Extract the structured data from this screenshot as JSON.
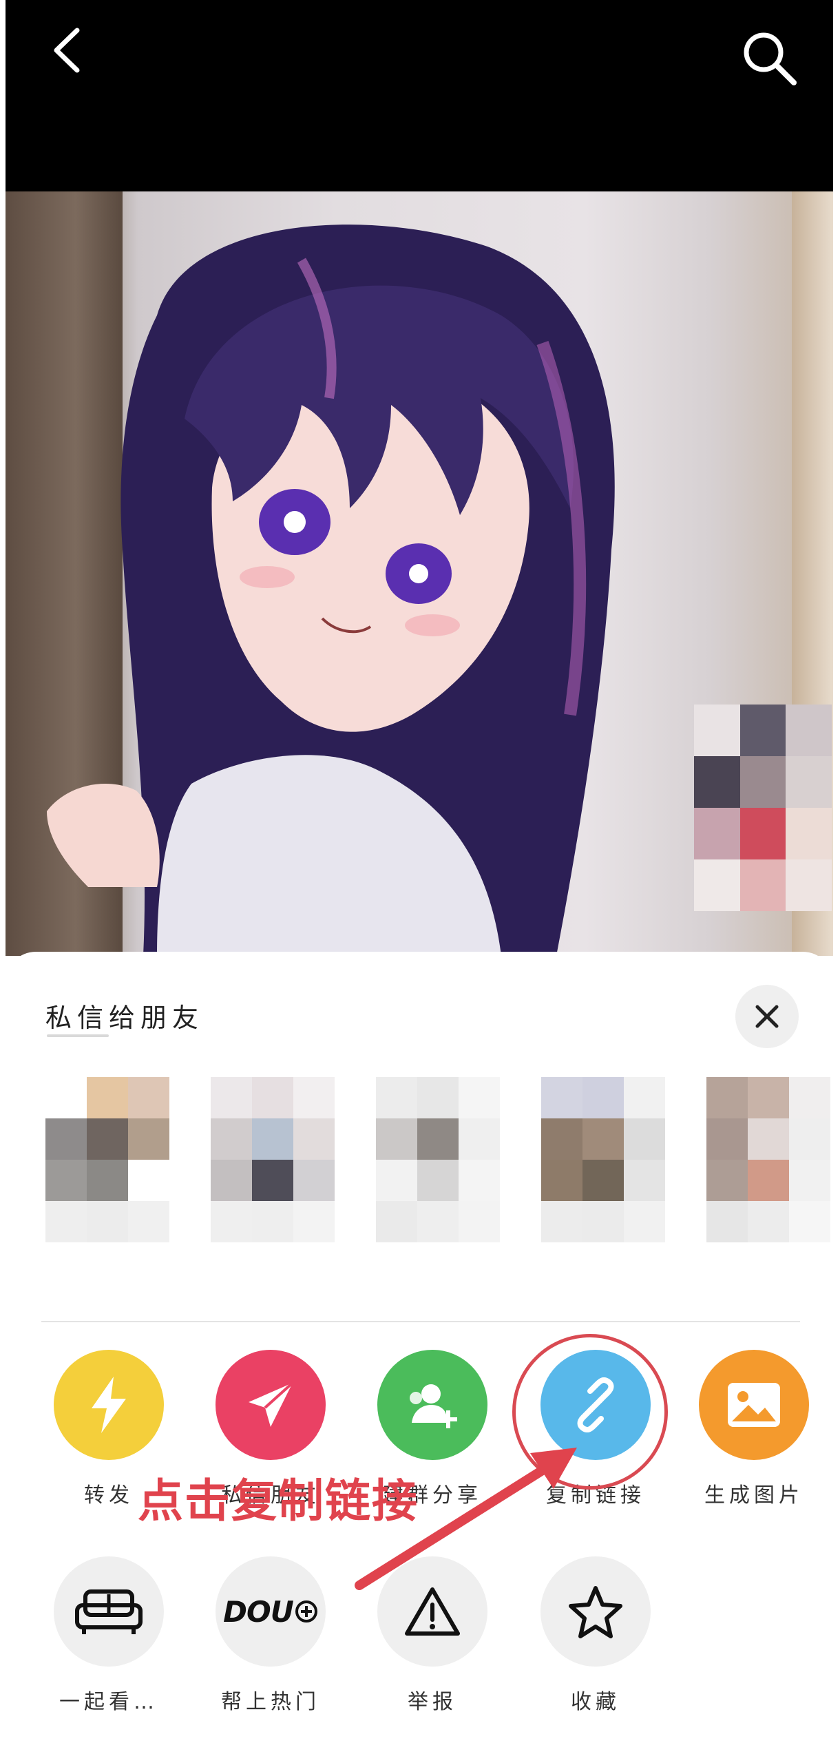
{
  "header": {
    "back_icon": "chevron-left-icon",
    "search_icon": "search-icon",
    "background": "#000000"
  },
  "share_sheet": {
    "title": "私信给朋友",
    "close_icon": "close-icon",
    "friends_count": 5,
    "actions_row1": [
      {
        "label": "转发",
        "icon": "lightning-icon",
        "color": "#f4cf3b"
      },
      {
        "label": "私信朋友",
        "icon": "send-icon",
        "color": "#ea4164"
      },
      {
        "label": "建群分享",
        "icon": "add-group-icon",
        "color": "#4bbc5b"
      },
      {
        "label": "复制链接",
        "icon": "link-icon",
        "color": "#58b8ea"
      },
      {
        "label": "生成图片",
        "icon": "image-icon",
        "color": "#f49a2d"
      }
    ],
    "actions_row2": [
      {
        "label": "一起看…",
        "icon": "sofa-icon"
      },
      {
        "label": "帮上热门",
        "icon": "dou-plus-icon",
        "icon_text": "DOU"
      },
      {
        "label": "举报",
        "icon": "warning-icon"
      },
      {
        "label": "收藏",
        "icon": "star-icon"
      }
    ]
  },
  "annotation": {
    "text": "点击复制链接",
    "color": "#e0434d"
  }
}
